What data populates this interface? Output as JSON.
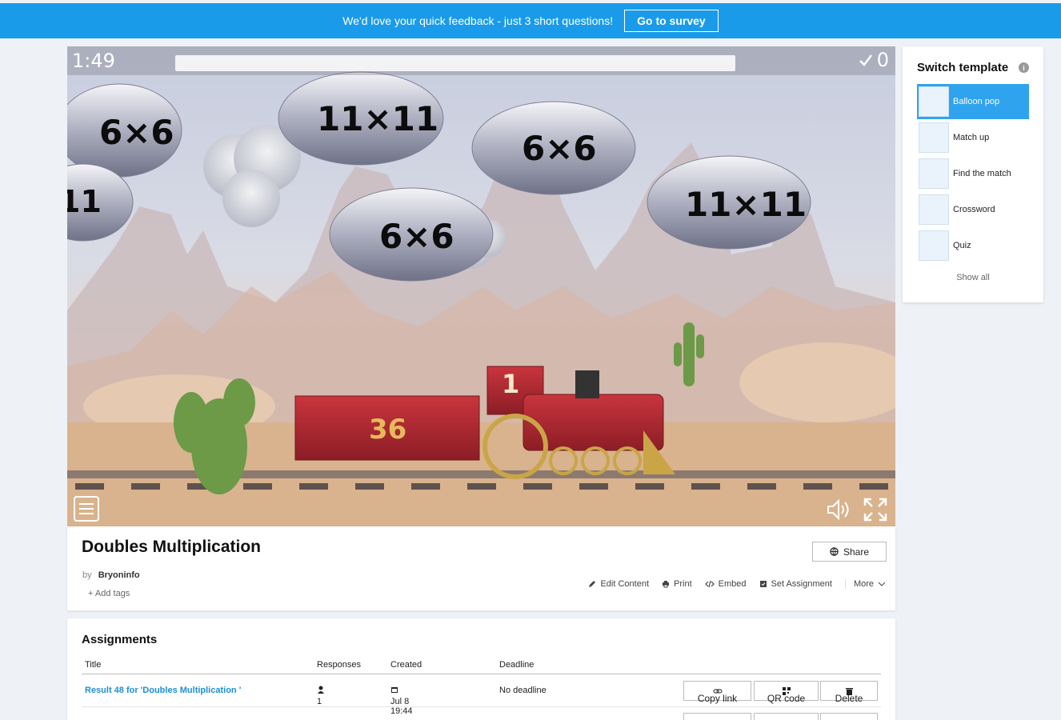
{
  "banner": {
    "message": "We'd love your quick feedback - just 3 short questions!",
    "cta": "Go to survey",
    "color": "#1a9bea"
  },
  "game": {
    "timer": "1:49",
    "score": "0",
    "blimps": [
      "6×6",
      "11",
      "11×11",
      "6×6",
      "6×6",
      "11×11"
    ],
    "train_number": "1",
    "wagon_value": "36"
  },
  "sidebar": {
    "title": "Switch template",
    "templates": [
      {
        "label": "Balloon pop",
        "icon": "balloon-pop-icon",
        "active": true
      },
      {
        "label": "Match up",
        "icon": "match-up-icon",
        "active": false
      },
      {
        "label": "Find the match",
        "icon": "find-the-match-icon",
        "active": false
      },
      {
        "label": "Crossword",
        "icon": "crossword-icon",
        "active": false
      },
      {
        "label": "Quiz",
        "icon": "quiz-icon",
        "active": false
      }
    ],
    "show_all": "Show all",
    "accent": "#2fa3ee"
  },
  "activity": {
    "title": "Doubles Multiplication",
    "by_label": "by",
    "author": "Bryoninfo",
    "add_tags": "Add tags",
    "share": "Share",
    "actions": {
      "edit": "Edit Content",
      "print": "Print",
      "embed": "Embed",
      "assign": "Set Assignment",
      "more": "More"
    }
  },
  "assignments": {
    "title": "Assignments",
    "columns": [
      "Title",
      "Responses",
      "Created",
      "Deadline"
    ],
    "rows": [
      {
        "title": "Result 48 for 'Doubles Multiplication '",
        "responses": "1",
        "created": "Jul 8 19:44",
        "deadline": "No deadline",
        "copy_link": "Copy link",
        "qr_code": "QR code",
        "delete": "Delete"
      }
    ]
  }
}
